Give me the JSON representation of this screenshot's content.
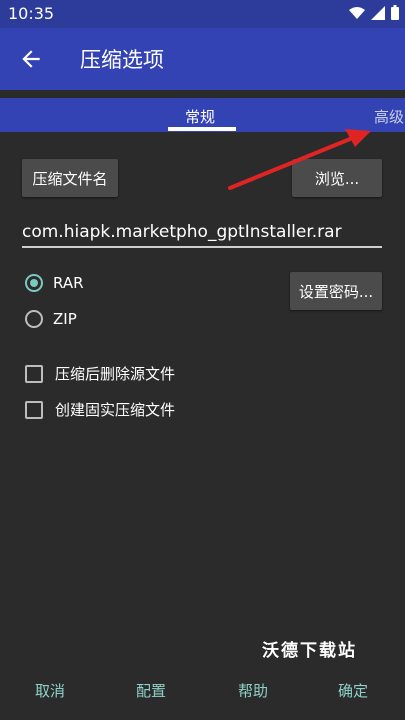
{
  "status_bar": {
    "time": "10:35",
    "icons": [
      "wifi-icon",
      "signal-icon",
      "battery-icon"
    ]
  },
  "app_bar": {
    "title": "压缩选项",
    "back_icon": "arrow-left-icon"
  },
  "tabs": [
    {
      "label": "常规",
      "selected": true
    },
    {
      "label": "高级",
      "selected": false
    }
  ],
  "general": {
    "archive_name_button": "压缩文件名",
    "browse_button": "浏览...",
    "filename_value": "com.hiapk.marketpho_gptInstaller.rar",
    "formats": [
      {
        "label": "RAR",
        "selected": true
      },
      {
        "label": "ZIP",
        "selected": false
      }
    ],
    "set_password_button": "设置密码...",
    "options": [
      {
        "label": "压缩后删除源文件",
        "checked": false
      },
      {
        "label": "创建固实压缩文件",
        "checked": false
      }
    ]
  },
  "watermark": "沃德下载站",
  "footer": {
    "cancel": "取消",
    "config": "配置",
    "help": "帮助",
    "ok": "确定"
  },
  "colors": {
    "app_bar": "#3443b3",
    "status_bar": "#2d3b9a",
    "background": "#2b2b2b",
    "accent": "#7bc9c0",
    "annotation_arrow": "#e02424"
  }
}
